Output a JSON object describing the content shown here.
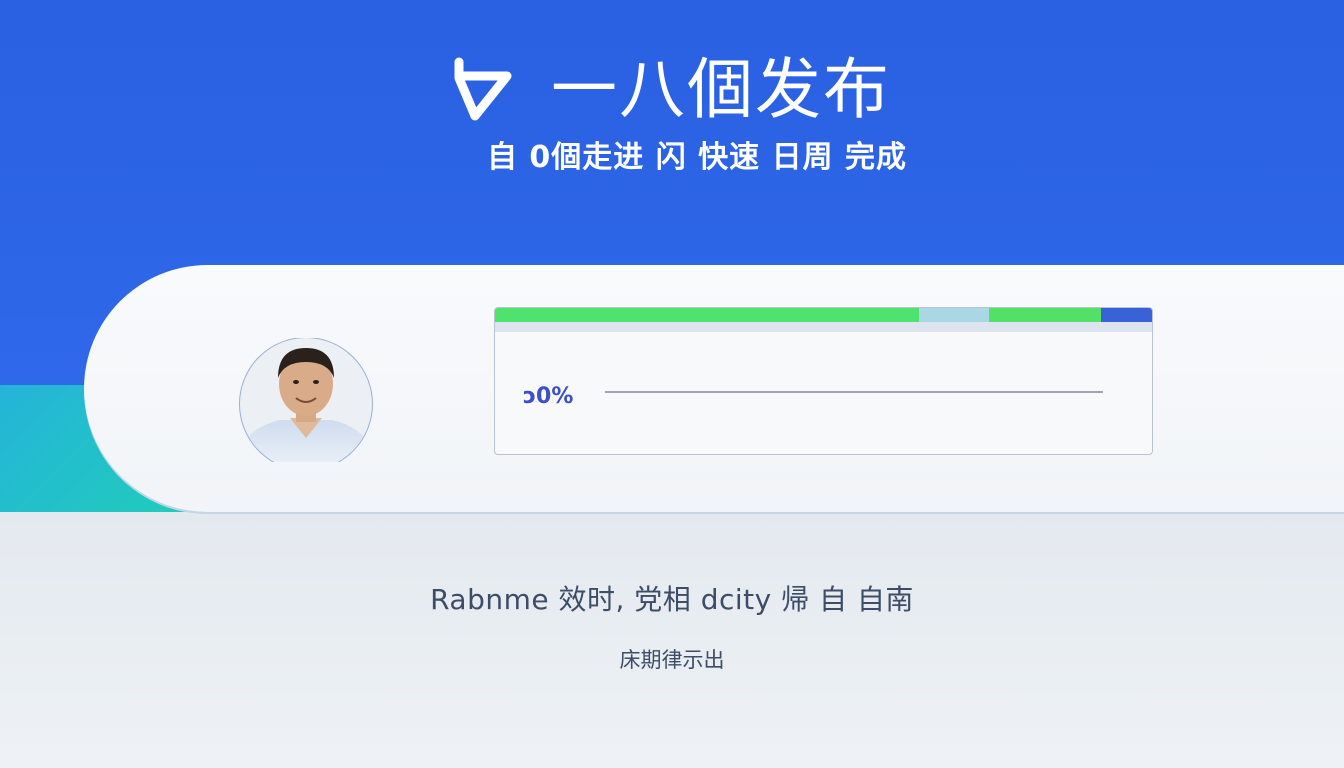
{
  "header": {
    "logo_icon": "check-logo-icon",
    "title": "一八個发布",
    "subtitle": "自 0個走进 闪 快速 日周 完成"
  },
  "profile": {
    "avatar_icon": "user-avatar"
  },
  "progress": {
    "percent_label": "ɔ0%",
    "segment_colors": [
      "#4ee36f",
      "#a9d7e3",
      "#52e066",
      "#3962d8"
    ]
  },
  "footer": {
    "caption": "Rabnme 效时, 党相 dcity 帰 自 自南",
    "subcaption": "床期律示出"
  },
  "colors": {
    "brand_blue": "#2a60e2",
    "accent_teal": "#1fd0b8",
    "percent_text": "#3d4fc4"
  }
}
